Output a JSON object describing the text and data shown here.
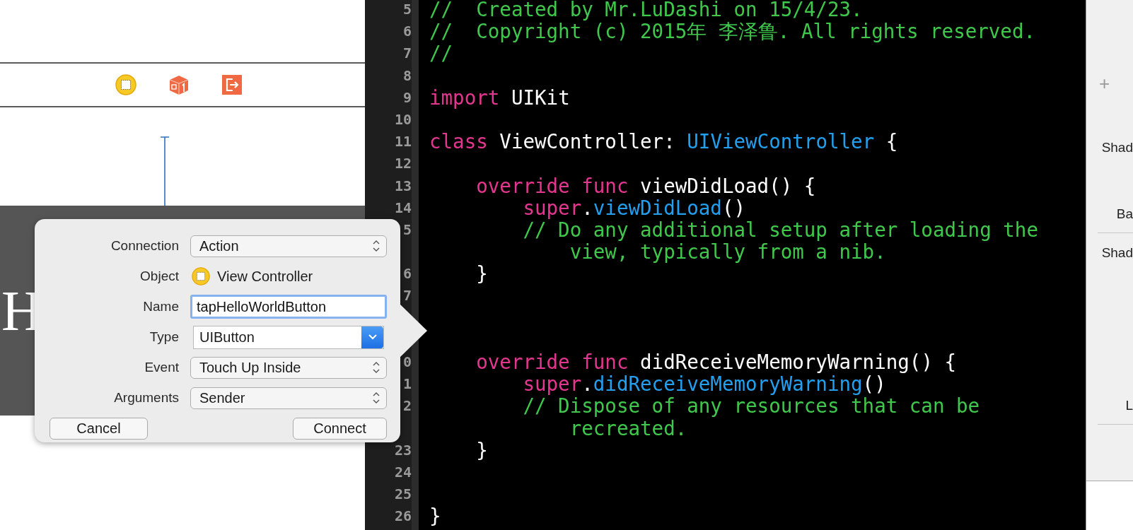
{
  "storyboard": {
    "icon_bar": [
      {
        "kind": "view-controller"
      },
      {
        "kind": "first-responder"
      },
      {
        "kind": "exit"
      }
    ],
    "button_title": "H"
  },
  "connection_popover": {
    "rows": [
      {
        "label": "Connection",
        "kind": "popup",
        "value": "Action"
      },
      {
        "label": "Object",
        "kind": "object",
        "value": "View Controller"
      },
      {
        "label": "Name",
        "kind": "text",
        "value": "tapHelloWorldButton",
        "focused": true
      },
      {
        "label": "Type",
        "kind": "combo",
        "value": "UIButton"
      },
      {
        "label": "Event",
        "kind": "popup",
        "value": "Touch Up Inside"
      },
      {
        "label": "Arguments",
        "kind": "popup",
        "value": "Sender"
      }
    ],
    "buttons": [
      {
        "label": "Cancel"
      },
      {
        "label": "Connect"
      }
    ]
  },
  "editor": {
    "rows": [
      {
        "number": "5",
        "segments": [
          {
            "kind": "comment",
            "text": "//  Created by Mr.LuDashi on 15/4/23."
          }
        ]
      },
      {
        "number": "6",
        "segments": [
          {
            "kind": "comment",
            "text": "//  Copyright (c) 2015年 李泽鲁. All rights reserved."
          }
        ]
      },
      {
        "number": "7",
        "segments": [
          {
            "kind": "comment",
            "text": "//"
          }
        ]
      },
      {
        "number": "8",
        "segments": []
      },
      {
        "number": "9",
        "segments": [
          {
            "kind": "keyword",
            "text": "import"
          },
          {
            "kind": "plain",
            "text": " UIKit"
          }
        ]
      },
      {
        "number": "10",
        "segments": []
      },
      {
        "number": "11",
        "segments": [
          {
            "kind": "keyword",
            "text": "class"
          },
          {
            "kind": "plain",
            "text": " ViewController: "
          },
          {
            "kind": "type",
            "text": "UIViewController"
          },
          {
            "kind": "plain",
            "text": " {"
          }
        ]
      },
      {
        "number": "12",
        "segments": []
      },
      {
        "number": "13",
        "segments": [
          {
            "kind": "keyword",
            "text": "    override func"
          },
          {
            "kind": "plain",
            "text": " viewDidLoad() {"
          }
        ]
      },
      {
        "number": "14",
        "segments": [
          {
            "kind": "keyword",
            "text": "        super"
          },
          {
            "kind": "plain",
            "text": "."
          },
          {
            "kind": "call",
            "text": "viewDidLoad"
          },
          {
            "kind": "plain",
            "text": "()"
          }
        ]
      },
      {
        "number": "5",
        "segments": [
          {
            "kind": "comment",
            "text": "        // Do any additional setup after loading the"
          }
        ]
      },
      {
        "segments": [
          {
            "kind": "comment",
            "text": "            view, typically from a nib."
          }
        ]
      },
      {
        "number": "6",
        "segments": [
          {
            "kind": "plain",
            "text": "    }"
          }
        ]
      },
      {
        "number": "7",
        "segments": []
      },
      {
        "segments": []
      },
      {
        "segments": []
      },
      {
        "number": "0",
        "segments": [
          {
            "kind": "keyword",
            "text": "    override func"
          },
          {
            "kind": "plain",
            "text": " didReceiveMemoryWarning() {"
          }
        ]
      },
      {
        "number": "1",
        "segments": [
          {
            "kind": "keyword",
            "text": "        super"
          },
          {
            "kind": "plain",
            "text": "."
          },
          {
            "kind": "call",
            "text": "didReceiveMemoryWarning"
          },
          {
            "kind": "plain",
            "text": "()"
          }
        ]
      },
      {
        "number": "2",
        "segments": [
          {
            "kind": "comment",
            "text": "        // Dispose of any resources that can be"
          }
        ]
      },
      {
        "segments": [
          {
            "kind": "comment",
            "text": "            recreated."
          }
        ]
      },
      {
        "number": "23",
        "segments": [
          {
            "kind": "plain",
            "text": "    }"
          }
        ]
      },
      {
        "number": "24",
        "segments": []
      },
      {
        "number": "25",
        "segments": []
      },
      {
        "number": "26",
        "segments": [
          {
            "kind": "plain",
            "text": "}"
          }
        ]
      }
    ]
  },
  "inspector": {
    "items": [
      {
        "kind": "add",
        "text": "+"
      },
      {
        "kind": "label",
        "text": "Shad"
      },
      {
        "kind": "label",
        "text": "Ba"
      },
      {
        "kind": "divider"
      },
      {
        "kind": "label",
        "text": "Shad"
      },
      {
        "kind": "label",
        "text": "L"
      },
      {
        "kind": "divider"
      }
    ]
  }
}
